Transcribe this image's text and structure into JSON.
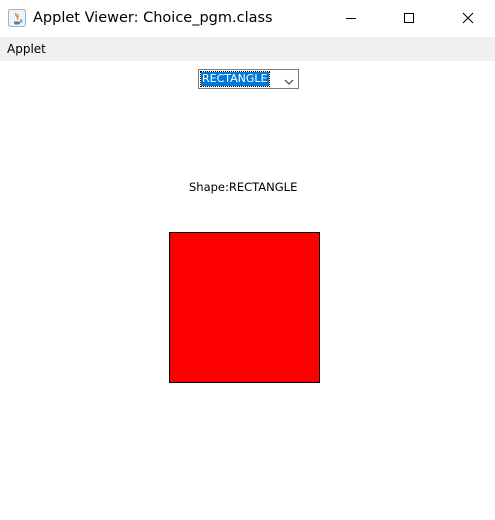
{
  "window": {
    "title": "Applet Viewer: Choice_pgm.class",
    "icon": "java-icon",
    "controls": {
      "minimize_icon": "minimize-icon",
      "maximize_icon": "maximize-icon",
      "close_icon": "close-icon"
    }
  },
  "menubar": {
    "items": [
      {
        "label": "Applet"
      }
    ]
  },
  "applet": {
    "choice": {
      "selected": "RECTANGLE",
      "arrow_icon": "chevron-down-icon",
      "highlight_color": "#0078d7"
    },
    "shape_label": "Shape:RECTANGLE",
    "shape": {
      "type": "rectangle",
      "fill_color": "#ff0000",
      "border_color": "#000000"
    }
  }
}
